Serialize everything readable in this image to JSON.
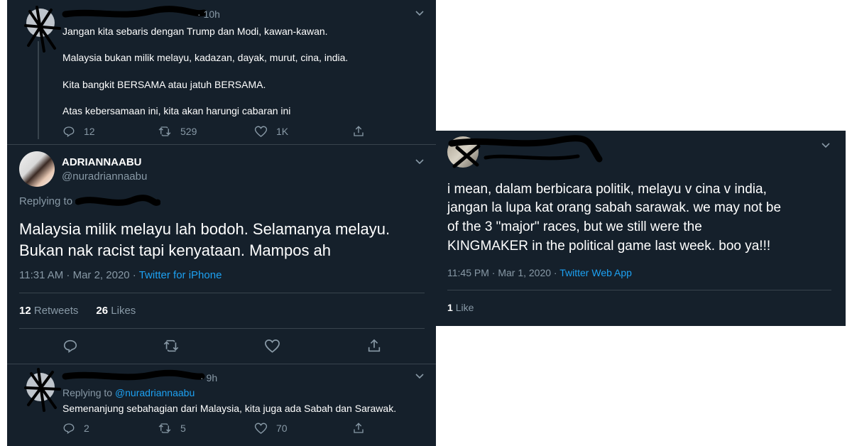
{
  "tweet1": {
    "time": "· 10h",
    "lines": [
      "Jangan kita sebaris dengan Trump dan Modi, kawan-kawan.",
      "Malaysia bukan milik melayu, kadazan, dayak, murut, cina, india.",
      "Kita bangkit BERSAMA atau jatuh BERSAMA.",
      "Atas kebersamaan ini, kita akan harungi cabaran ini"
    ],
    "replies": "12",
    "retweets": "529",
    "likes": "1K"
  },
  "main_tweet": {
    "display_name": "ADRIANNAABU",
    "handle": "@nuradriannaabu",
    "replying_to": "Replying to",
    "text_line1": "Malaysia milik melayu lah bodoh. Selamanya melayu.",
    "text_line2": "Bukan nak racist tapi kenyataan. Mampos ah",
    "timestamp": "11:31 AM · Mar 2, 2020 · ",
    "source": "Twitter for iPhone",
    "retweet_count": "12",
    "retweet_label": "Retweets",
    "like_count": "26",
    "like_label": "Likes"
  },
  "tweet3": {
    "time": "· 9h",
    "replying_prefix": "Replying to ",
    "replying_handle": "@nuradriannaabu",
    "text": "Semenanjung sebahagian dari Malaysia, kita juga ada Sabah dan Sarawak.",
    "replies": "2",
    "retweets": "5",
    "likes": "70"
  },
  "right_tweet": {
    "lines": [
      "i mean, dalam berbicara politik, melayu v cina v india,",
      "jangan la lupa kat orang sabah sarawak. we may not be",
      "of the 3 \"major\" races, but we still were the",
      "KINGMAKER in the political game last week. boo ya!!!"
    ],
    "timestamp": "11:45 PM · Mar 1, 2020 · ",
    "source": "Twitter Web App",
    "like_count": "1",
    "like_label": "Like"
  },
  "icons": {
    "reply": "reply-icon",
    "retweet": "retweet-icon",
    "like": "heart-icon",
    "share": "share-icon",
    "caret": "chevron-down-icon"
  },
  "colors": {
    "background": "#15202b",
    "secondary_text": "#8899a6",
    "link": "#1da1f2",
    "divider": "#38444d"
  }
}
